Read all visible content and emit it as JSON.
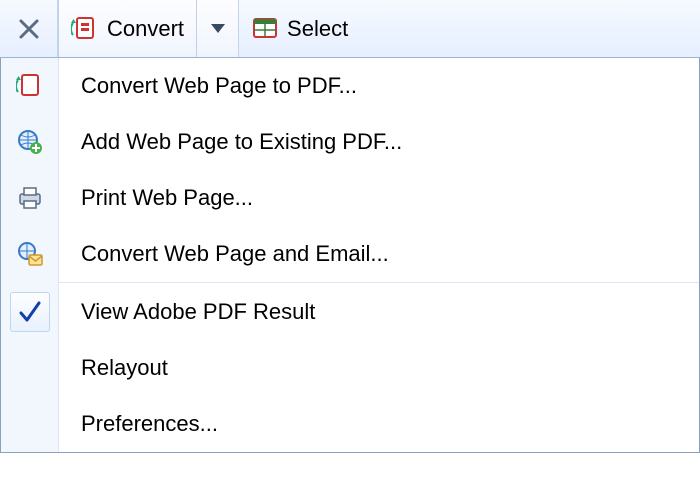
{
  "toolbar": {
    "close_label": "×",
    "convert_label": "Convert",
    "select_label": "Select"
  },
  "menu": {
    "items": [
      {
        "label": "Convert Web Page to PDF...",
        "icon": "pdf-convert-icon",
        "checked": false
      },
      {
        "label": "Add Web Page to Existing PDF...",
        "icon": "globe-add-icon",
        "checked": false
      },
      {
        "label": "Print Web Page...",
        "icon": "printer-icon",
        "checked": false
      },
      {
        "label": "Convert Web Page and Email...",
        "icon": "globe-mail-icon",
        "checked": false
      }
    ],
    "items2": [
      {
        "label": "View Adobe PDF Result",
        "icon": null,
        "checked": true
      },
      {
        "label": "Relayout",
        "icon": null,
        "checked": false
      },
      {
        "label": "Preferences...",
        "icon": null,
        "checked": false
      }
    ]
  }
}
